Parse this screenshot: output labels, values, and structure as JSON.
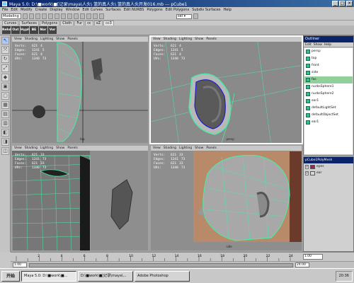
{
  "window": {
    "title": "Maya 5.0: D:\\■work\\■[记录\\maya\\人头\\ 篮的真人头\\ 篮的真人头开发016.mb --- pCube1",
    "min": "_",
    "max": "□",
    "close": "×"
  },
  "menubar": [
    "File",
    "Edit",
    "Modify",
    "Create",
    "Display",
    "Window",
    "Edit Curves",
    "Surfaces",
    "Edit NURBS",
    "Polygons",
    "Edit Polygons",
    "Subdiv Surfaces",
    "Help"
  ],
  "statusline": {
    "mode": "Modeling",
    "field_label": "sel ▾"
  },
  "shelf_tabs": [
    "Curves",
    "Surfaces",
    "Polygons",
    "Cloth",
    "Fur",
    "cc",
    "xZ",
    "cc3"
  ],
  "shelf_buttons": [
    "Rehd",
    "Out",
    "Hyph",
    "BE",
    "Nor",
    "Vor"
  ],
  "tools": [
    "↖",
    "⤧",
    "↻",
    "⤢",
    "◆",
    "▣",
    "▢",
    "▦",
    "▤",
    "▥",
    "◧",
    "◨",
    "◫"
  ],
  "viewports": [
    {
      "menu": [
        "View",
        "Shading",
        "Lighting",
        "Show",
        "Panels"
      ],
      "hud": [
        [
          "Verts:",
          "621",
          "4"
        ],
        [
          "Edges:",
          "1241",
          "5"
        ],
        [
          "Faces:",
          "621",
          "4"
        ],
        [
          "UVs:",
          "1340",
          "73"
        ]
      ],
      "camera": "top"
    },
    {
      "menu": [
        "View",
        "Shading",
        "Lighting",
        "Show",
        "Panels"
      ],
      "hud": [
        [
          "Verts:",
          "621",
          "4"
        ],
        [
          "Edges:",
          "1241",
          "5"
        ],
        [
          "Faces:",
          "621",
          "4"
        ],
        [
          "UVs:",
          "1340",
          "73"
        ]
      ],
      "camera": "persp"
    },
    {
      "menu": [
        "View",
        "Shading",
        "Lighting",
        "Show",
        "Panels"
      ],
      "hud": [
        [
          "Verts:",
          "621",
          "33"
        ],
        [
          "Edges:",
          "1241",
          "73"
        ],
        [
          "Faces:",
          "621",
          "33"
        ],
        [
          "UVs:",
          "1340",
          "73"
        ]
      ],
      "camera": "front"
    },
    {
      "menu": [
        "View",
        "Shading",
        "Lighting",
        "Show",
        "Panels"
      ],
      "hud": [
        [
          "Verts:",
          "621",
          "33"
        ],
        [
          "Edges:",
          "1241",
          "73"
        ],
        [
          "Faces:",
          "621",
          "33"
        ],
        [
          "UVs:",
          "1340",
          "73"
        ]
      ],
      "camera": "side"
    }
  ],
  "outliner": {
    "title": "Outliner",
    "menu": [
      "Edit",
      "Show",
      "Help"
    ],
    "items": [
      "persp",
      "top",
      "front",
      "side",
      "fas",
      "nurbsSphere1",
      "nurbsSphere2",
      "ear1",
      "defaultLightSet",
      "defaultObjectSet",
      "ear1"
    ],
    "selected_index": 4
  },
  "layers": {
    "title": "pCube1PolyMesh",
    "rows": [
      {
        "vis": "V",
        "name": "eyes",
        "color": "#a02060"
      },
      {
        "vis": "V",
        "name": "ear",
        "color": "#d8d8d8"
      }
    ]
  },
  "timeslider": {
    "ticks": [
      "2",
      "4",
      "6",
      "8",
      "10",
      "12",
      "14",
      "16",
      "18",
      "20",
      "22",
      "24"
    ],
    "current": "1.00"
  },
  "rangeslider": {
    "start": "1.00",
    "end": "24.00"
  },
  "taskbar": {
    "start": "开始",
    "buttons": [
      "Maya 5.0: D:\\■work\\■...",
      "D:\\■work\\■[记录\\maya\\...",
      "Adobe Photoshop"
    ],
    "pressed_index": 0,
    "clock": "20:36"
  },
  "colors": {
    "wire": "#4ee8a6",
    "selected_edge": "#1e1ed0",
    "ground": "#8e8e8e"
  }
}
